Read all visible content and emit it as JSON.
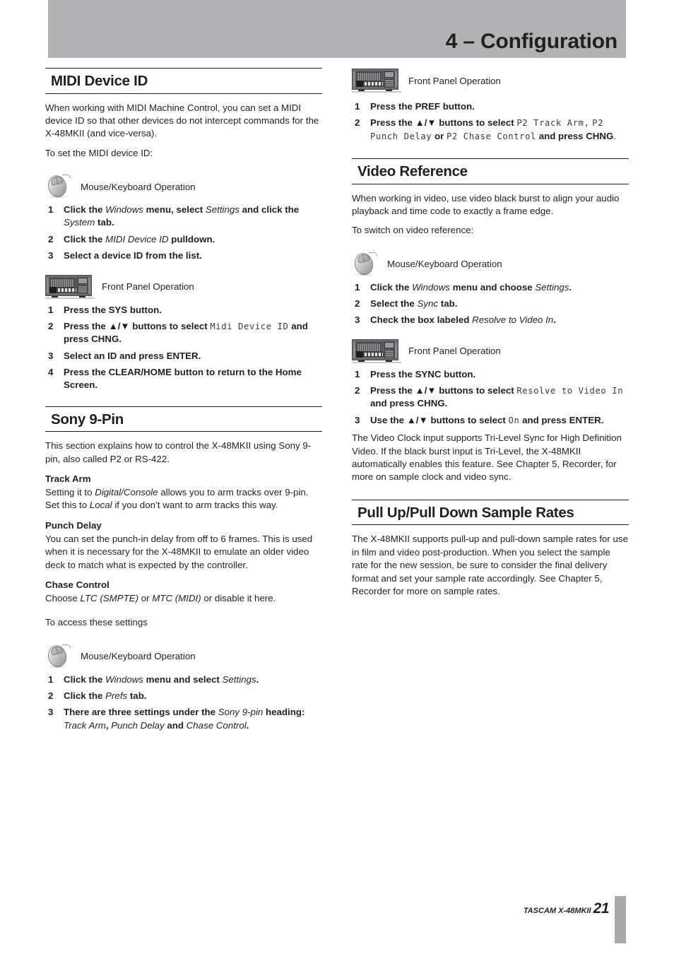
{
  "header": {
    "chapter_title": "4 – Configuration"
  },
  "footer": {
    "brand": "TASCAM X-48MKII",
    "page_number": "21"
  },
  "icons": {
    "mouse_label": "Mouse/Keyboard Operation",
    "panel_label": "Front Panel Operation"
  },
  "left_column": {
    "midi_device_id": {
      "heading": "MIDI Device ID",
      "intro_1": "When working with MIDI Machine Control, you can set a MIDI device ID so that other devices do not intercept commands for the X-48MKII (and vice-versa).",
      "intro_2": "To set the MIDI device ID:",
      "mouse_label": "Mouse/Keyboard Operation",
      "mouse_steps": [
        {
          "num": "1",
          "parts": [
            {
              "t": "Click the ",
              "s": "b"
            },
            {
              "t": "Windows",
              "s": "bi"
            },
            {
              "t": " menu, select ",
              "s": "b"
            },
            {
              "t": "Settings",
              "s": "bi"
            },
            {
              "t": " and click the ",
              "s": "b"
            },
            {
              "t": "System",
              "s": "bi"
            },
            {
              "t": " tab.",
              "s": "b"
            }
          ]
        },
        {
          "num": "2",
          "parts": [
            {
              "t": "Click the ",
              "s": "b"
            },
            {
              "t": "MIDI Device ID",
              "s": "bi"
            },
            {
              "t": " pulldown.",
              "s": "b"
            }
          ]
        },
        {
          "num": "3",
          "parts": [
            {
              "t": "Select a device ID from the list.",
              "s": "b"
            }
          ]
        }
      ],
      "panel_label": "Front Panel Operation",
      "panel_steps": [
        {
          "num": "1",
          "parts": [
            {
              "t": "Press the SYS button.",
              "s": "b"
            }
          ]
        },
        {
          "num": "2",
          "parts": [
            {
              "t": "Press the ",
              "s": "b"
            },
            {
              "t": "▲/▼",
              "s": "b"
            },
            {
              "t": " buttons to select ",
              "s": "b"
            },
            {
              "t": "Midi Device ID",
              "s": "m"
            },
            {
              "t": " and press CHNG.",
              "s": "b"
            }
          ]
        },
        {
          "num": "3",
          "parts": [
            {
              "t": "Select an ID and press ENTER.",
              "s": "b"
            }
          ]
        },
        {
          "num": "4",
          "parts": [
            {
              "t": "Press the CLEAR/HOME button to return to the Home Screen.",
              "s": "b"
            }
          ]
        }
      ]
    },
    "sony_9pin": {
      "heading": "Sony 9-Pin",
      "intro": "This section explains how to control the X-48MKII using Sony 9-pin, also called P2 or RS-422.",
      "subsections": [
        {
          "title": "Track Arm",
          "parts": [
            {
              "t": "Setting it to ",
              "s": "n"
            },
            {
              "t": "Digital/Console",
              "s": "i"
            },
            {
              "t": " allows you to arm tracks over 9-pin. Set this to ",
              "s": "n"
            },
            {
              "t": "Local",
              "s": "i"
            },
            {
              "t": " if you don’t want to arm tracks this way.",
              "s": "n"
            }
          ]
        },
        {
          "title": "Punch Delay",
          "parts": [
            {
              "t": "You can set the punch-in delay from off to 6 frames. This is used when it is necessary for the X-48MKII to emulate an older video deck to match what is expected by the controller.",
              "s": "n"
            }
          ]
        },
        {
          "title": "Chase Control",
          "parts": [
            {
              "t": "Choose ",
              "s": "n"
            },
            {
              "t": "LTC (SMPTE)",
              "s": "i"
            },
            {
              "t": " or ",
              "s": "n"
            },
            {
              "t": "MTC (MIDI)",
              "s": "i"
            },
            {
              "t": " or disable it here.",
              "s": "n"
            }
          ]
        }
      ],
      "access_line": "To access these settings",
      "mouse_label": "Mouse/Keyboard Operation",
      "mouse_steps": [
        {
          "num": "1",
          "parts": [
            {
              "t": "Click the ",
              "s": "b"
            },
            {
              "t": "Windows",
              "s": "bi"
            },
            {
              "t": " menu and select ",
              "s": "b"
            },
            {
              "t": "Settings",
              "s": "bi"
            },
            {
              "t": ".",
              "s": "b"
            }
          ]
        },
        {
          "num": "2",
          "parts": [
            {
              "t": "Click the ",
              "s": "b"
            },
            {
              "t": "Prefs",
              "s": "bi"
            },
            {
              "t": " tab.",
              "s": "b"
            }
          ]
        },
        {
          "num": "3",
          "parts": [
            {
              "t": "There are three settings under the ",
              "s": "b"
            },
            {
              "t": "Sony 9-pin",
              "s": "bi"
            },
            {
              "t": " heading: ",
              "s": "b"
            },
            {
              "t": "Track Arm",
              "s": "bi"
            },
            {
              "t": ", ",
              "s": "b"
            },
            {
              "t": "Punch Delay",
              "s": "bi"
            },
            {
              "t": " and ",
              "s": "b"
            },
            {
              "t": "Chase Control",
              "s": "bi"
            },
            {
              "t": ".",
              "s": "b"
            }
          ]
        }
      ]
    }
  },
  "right_column": {
    "sony_panel": {
      "panel_label": "Front Panel Operation",
      "panel_steps": [
        {
          "num": "1",
          "parts": [
            {
              "t": "Press the PREF button.",
              "s": "b"
            }
          ]
        },
        {
          "num": "2",
          "parts": [
            {
              "t": "Press the ",
              "s": "b"
            },
            {
              "t": "▲/▼",
              "s": "b"
            },
            {
              "t": " buttons to select ",
              "s": "b"
            },
            {
              "t": "P2 Track Arm,",
              "s": "m"
            },
            {
              "t": " ",
              "s": "n"
            },
            {
              "t": "P2 Punch Delay",
              "s": "m"
            },
            {
              "t": " or ",
              "s": "b"
            },
            {
              "t": "P2 Chase Control",
              "s": "m"
            },
            {
              "t": " and press CHNG",
              "s": "b"
            },
            {
              "t": ".",
              "s": "n"
            }
          ]
        }
      ]
    },
    "video_reference": {
      "heading": "Video Reference",
      "intro_1": "When working in video, use video black burst to align your audio playback and time code to exactly a frame edge.",
      "intro_2": "To switch on video reference:",
      "mouse_label": "Mouse/Keyboard Operation",
      "mouse_steps": [
        {
          "num": "1",
          "parts": [
            {
              "t": "Click the ",
              "s": "b"
            },
            {
              "t": "Windows",
              "s": "bi"
            },
            {
              "t": " menu and choose ",
              "s": "b"
            },
            {
              "t": "Settings",
              "s": "bi"
            },
            {
              "t": ".",
              "s": "b"
            }
          ]
        },
        {
          "num": "2",
          "parts": [
            {
              "t": "Select the ",
              "s": "b"
            },
            {
              "t": "Sync",
              "s": "bi"
            },
            {
              "t": " tab.",
              "s": "b"
            }
          ]
        },
        {
          "num": "3",
          "parts": [
            {
              "t": "Check the box labeled ",
              "s": "b"
            },
            {
              "t": "Resolve to Video In",
              "s": "bi"
            },
            {
              "t": ".",
              "s": "b"
            }
          ]
        }
      ],
      "panel_label": "Front Panel Operation",
      "panel_steps": [
        {
          "num": "1",
          "parts": [
            {
              "t": "Press the SYNC button.",
              "s": "b"
            }
          ]
        },
        {
          "num": "2",
          "parts": [
            {
              "t": "Press the ",
              "s": "b"
            },
            {
              "t": "▲/▼",
              "s": "b"
            },
            {
              "t": " buttons to select ",
              "s": "b"
            },
            {
              "t": "Resolve to Video In",
              "s": "m"
            },
            {
              "t": " and press CHNG.",
              "s": "b"
            }
          ]
        },
        {
          "num": "3",
          "parts": [
            {
              "t": "Use the ",
              "s": "b"
            },
            {
              "t": "▲/▼",
              "s": "b"
            },
            {
              "t": " buttons to select ",
              "s": "b"
            },
            {
              "t": "On",
              "s": "m"
            },
            {
              "t": " and press ENTER.",
              "s": "b"
            }
          ]
        }
      ],
      "closing": "The Video Clock input supports Tri-Level Sync for High Definition Video. If the black burst input is Tri-Level, the X-48MKII automatically enables this feature. See Chapter 5, Recorder, for more on sample clock and video sync."
    },
    "pull_rates": {
      "heading": "Pull Up/Pull Down Sample Rates",
      "body": "The X-48MKII supports pull-up and pull-down sample rates for use in film and video post-production. When you select the sample rate for the new session, be sure to consider the final delivery format and set your sample rate accordingly. See Chapter 5, Recorder for more on sample rates."
    }
  }
}
